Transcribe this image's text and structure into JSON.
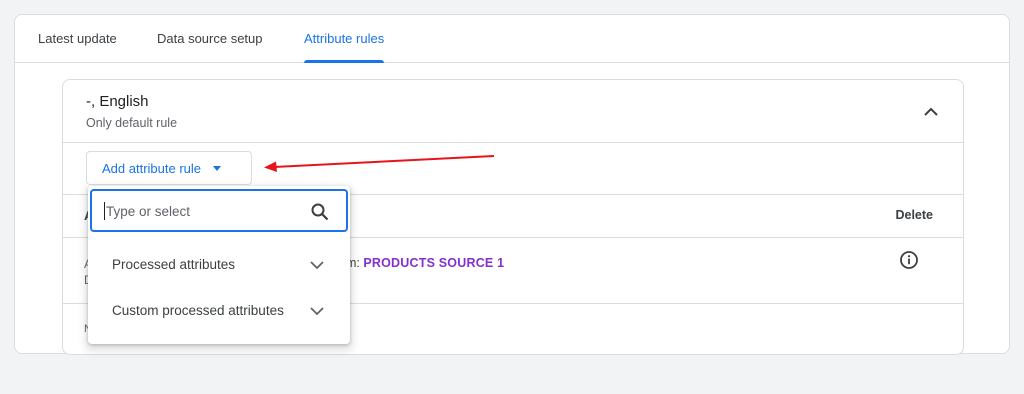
{
  "tabs": [
    {
      "label": "Latest update"
    },
    {
      "label": "Data source setup"
    },
    {
      "label": "Attribute rules"
    }
  ],
  "section": {
    "title": "-, English",
    "subtitle": "Only default rule"
  },
  "add_rule": {
    "label": "Add attribute rule"
  },
  "table": {
    "col_left_fragment": "A",
    "col_delete": "Delete",
    "row": {
      "left_fragment_1": "A",
      "left_fragment_2": "D",
      "prefix": "m: ",
      "source": "PRODUCTS SOURCE 1"
    },
    "footer_fragment": "N"
  },
  "dropdown": {
    "placeholder": "Type or select",
    "items": [
      {
        "label": "Processed attributes"
      },
      {
        "label": "Custom processed attributes"
      }
    ]
  },
  "colors": {
    "accent": "#1a73e8",
    "source_link": "#8430ce",
    "annotation_arrow": "#e8141b"
  },
  "icons": {
    "collapse": "chevron-up-icon",
    "dropdown_caret": "caret-down-icon",
    "search": "search-icon",
    "expand": "chevron-down-icon",
    "info": "info-icon"
  }
}
